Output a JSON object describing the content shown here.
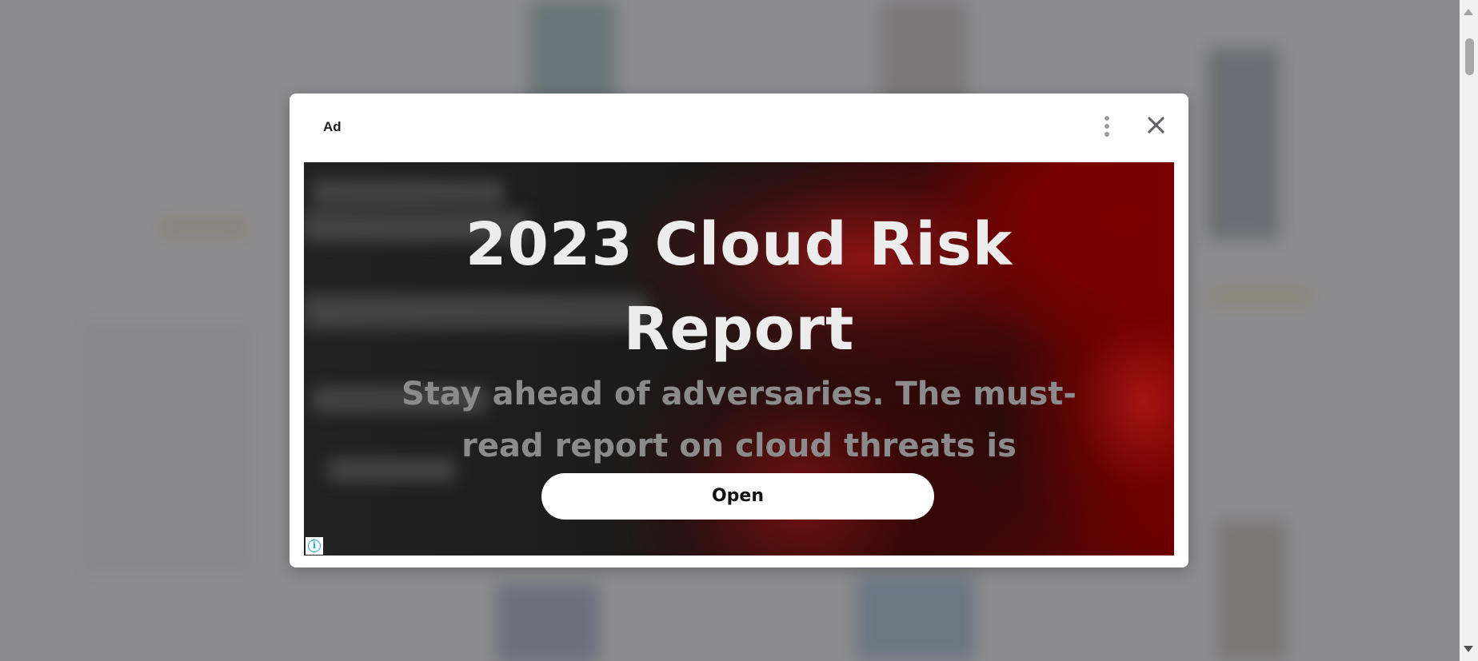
{
  "modal": {
    "ad_label": "Ad",
    "more_options_icon": "three-dots-vertical-icon",
    "close_icon": "close-x-icon"
  },
  "ad": {
    "headline_line1": "2023 Cloud Risk",
    "headline_line2": "Report",
    "subtext": "Stay ahead of adversaries. The must-read report on cloud threats is",
    "cta_label": "Open",
    "adchoices_glyph": "i",
    "adchoices_icon": "info-circle-icon"
  },
  "colors": {
    "overlay": "#78787c",
    "modal_bg": "#ffffff",
    "ad_dark": "#1c1c1c",
    "ad_red": "#7a0000",
    "headline": "#ececec",
    "subtext": "#8b8b8b",
    "adchoices": "#1ea7d8"
  }
}
